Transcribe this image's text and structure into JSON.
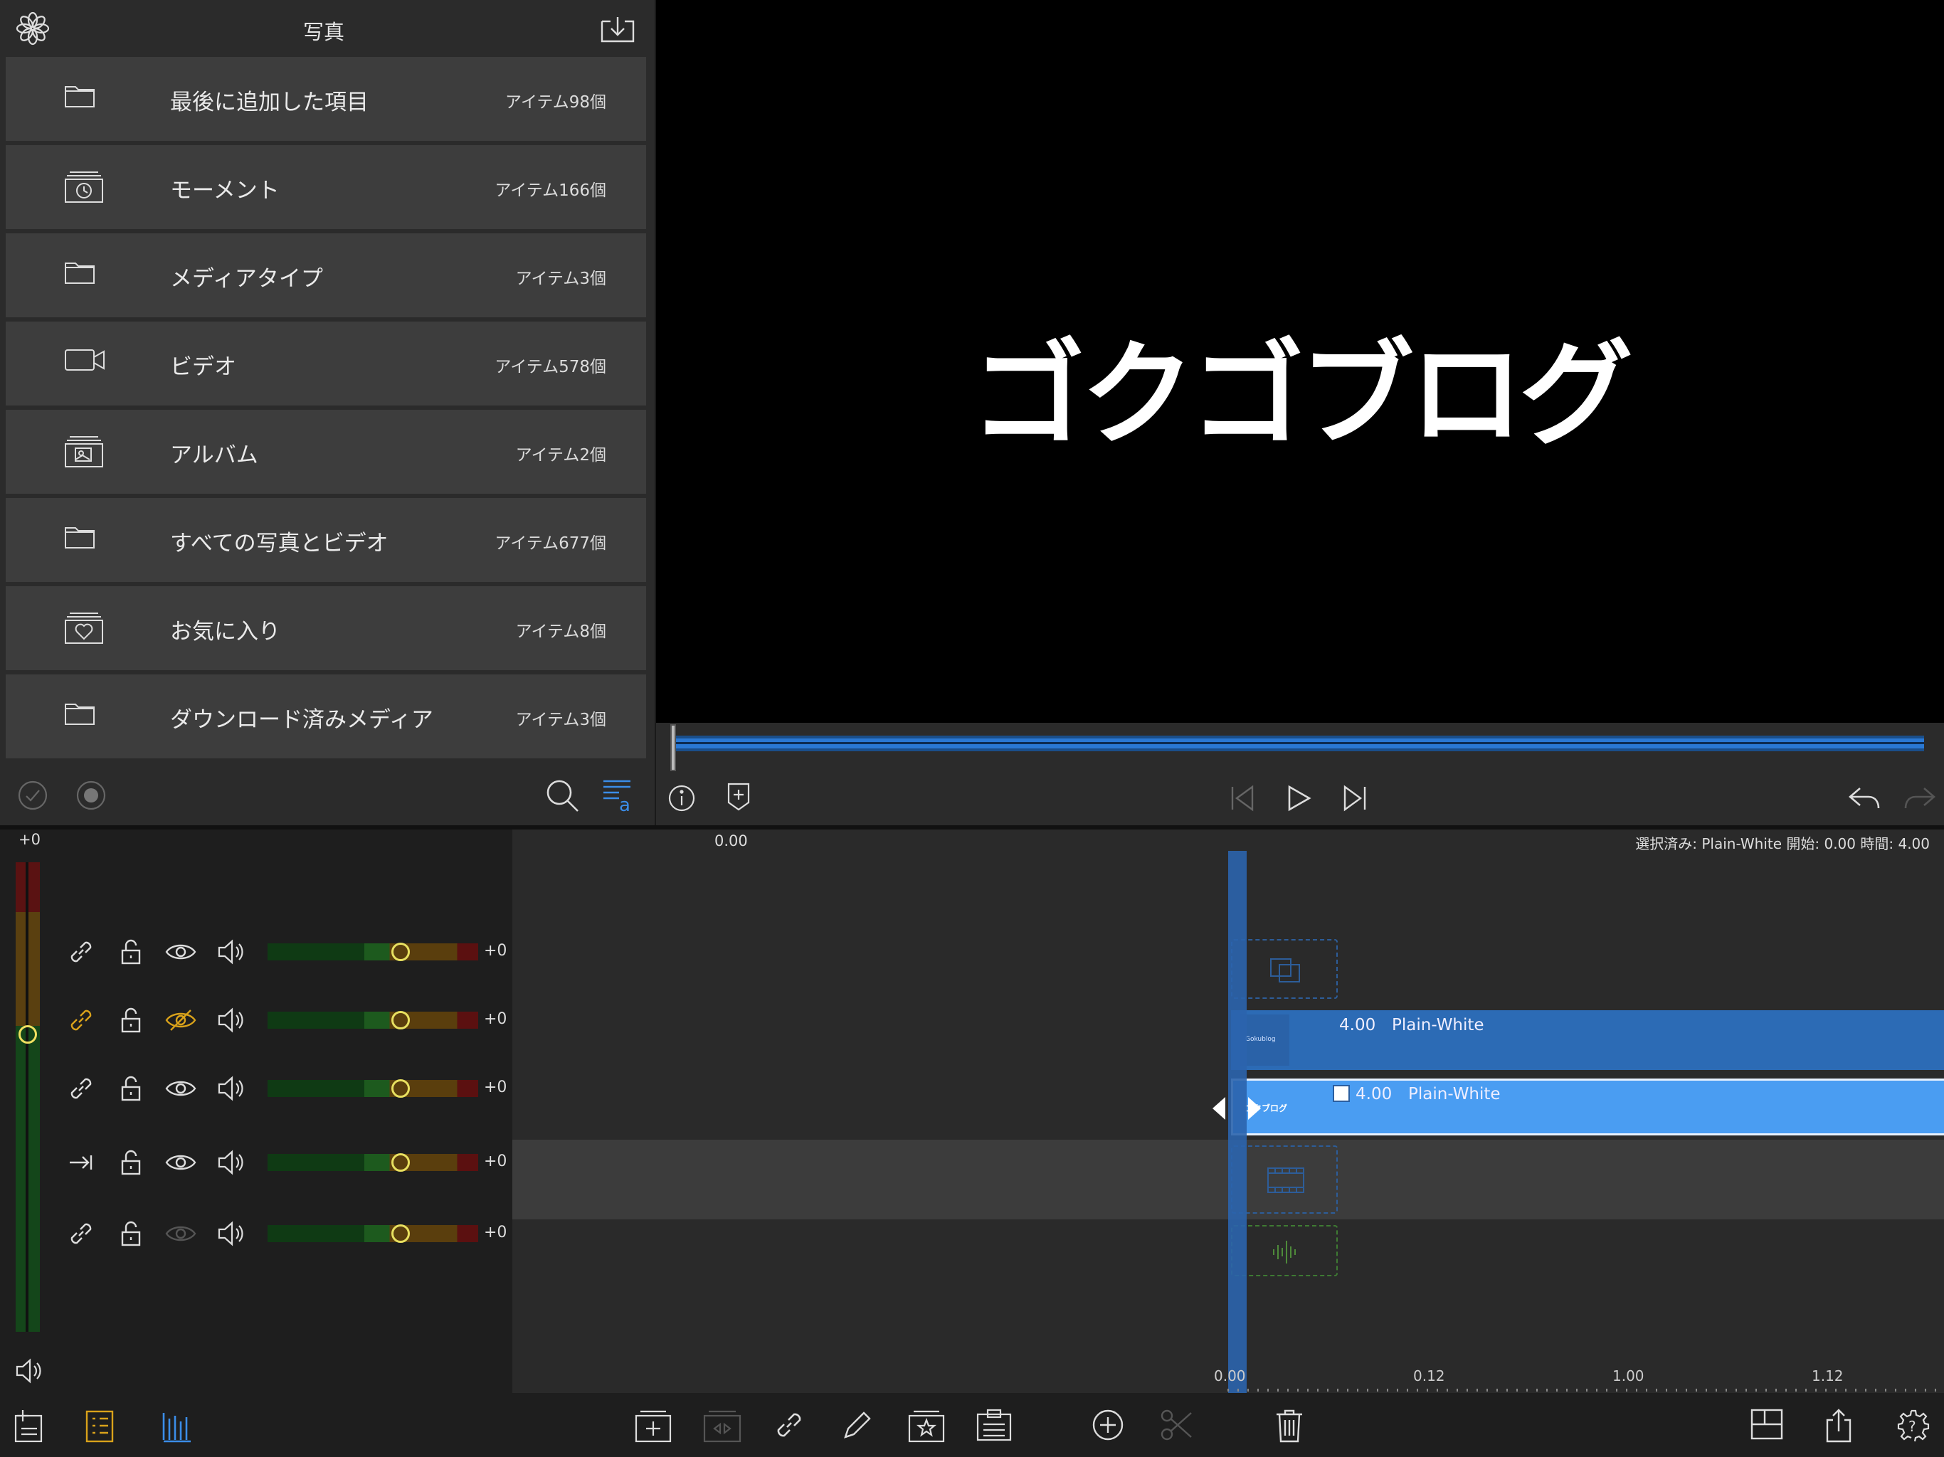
{
  "media_browser": {
    "title": "写真",
    "items": [
      {
        "label": "最後に追加した項目",
        "count": "アイテム98個",
        "icon": "folder-icon"
      },
      {
        "label": "モーメント",
        "count": "アイテム166個",
        "icon": "moments-icon"
      },
      {
        "label": "メディアタイプ",
        "count": "アイテム3個",
        "icon": "folder-icon"
      },
      {
        "label": "ビデオ",
        "count": "アイテム578個",
        "icon": "video-camera-icon"
      },
      {
        "label": "アルバム",
        "count": "アイテム2個",
        "icon": "album-icon"
      },
      {
        "label": "すべての写真とビデオ",
        "count": "アイテム677個",
        "icon": "folder-icon"
      },
      {
        "label": "お気に入り",
        "count": "アイテム8個",
        "icon": "favorites-icon"
      },
      {
        "label": "ダウンロード済みメディア",
        "count": "アイテム3個",
        "icon": "folder-icon"
      }
    ]
  },
  "viewer": {
    "preview_title": "ゴクゴブログ"
  },
  "tracks": {
    "master_value": "+0",
    "rows": [
      {
        "value": "+0",
        "link": "link-icon",
        "visible": true
      },
      {
        "value": "+0",
        "link": "link-icon-active",
        "visible": false
      },
      {
        "value": "+0",
        "link": "link-icon",
        "visible": true
      },
      {
        "value": "+0",
        "link": "arrow-to-line-icon",
        "visible": true
      },
      {
        "value": "+0",
        "link": "link-icon",
        "visible": "dimmed"
      }
    ]
  },
  "timeline": {
    "playhead_time": "0.00",
    "status": "選択済み: Plain-White 開始: 0.00 時間: 4.00",
    "clips": [
      {
        "duration": "4.00",
        "name": "Plain-White",
        "thumb_text": "Gokublog"
      },
      {
        "duration": "4.00",
        "name": "Plain-White",
        "thumb_text": "ゴクブログ"
      }
    ],
    "ruler_labels": [
      "0.00",
      "0.12",
      "1.00",
      "1.12"
    ]
  },
  "colors": {
    "accent_blue": "#2a78d3",
    "clip_blue": "#2c6bb5",
    "clip_selected": "#4a9df2",
    "active_yellow": "#d9a21a"
  }
}
